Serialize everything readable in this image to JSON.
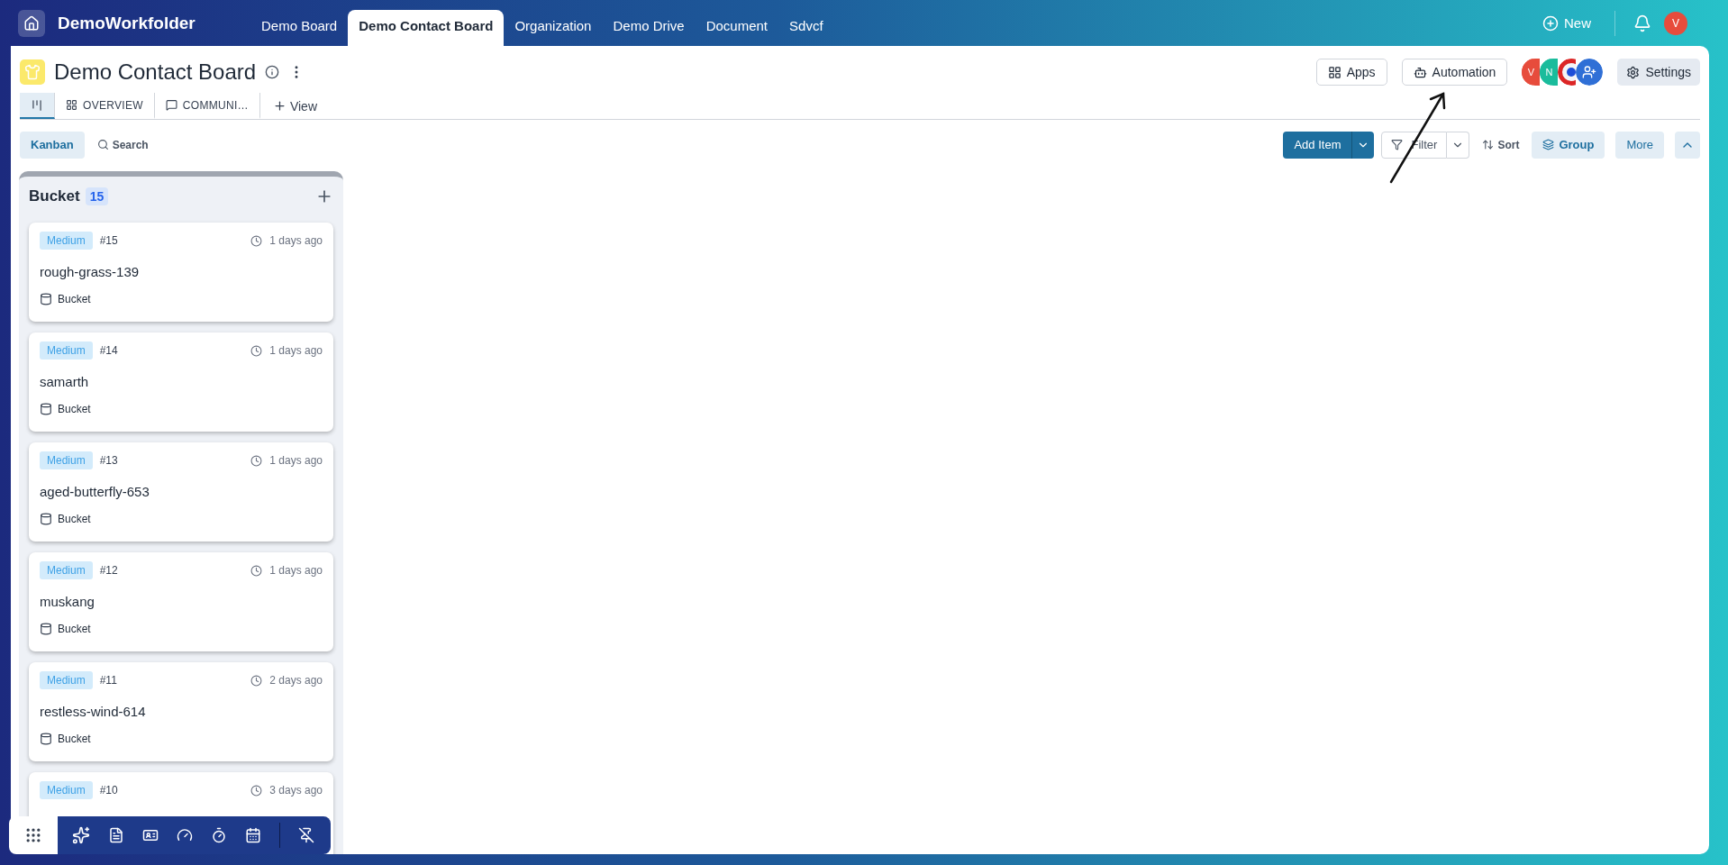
{
  "app": {
    "name": "DemoWorkfolder"
  },
  "nav_tabs": [
    {
      "label": "Demo Board",
      "selected": false
    },
    {
      "label": "Demo Contact Board",
      "selected": true
    },
    {
      "label": "Organization",
      "selected": false
    },
    {
      "label": "Demo Drive",
      "selected": false
    },
    {
      "label": "Document",
      "selected": false
    },
    {
      "label": "Sdvcf",
      "selected": false
    }
  ],
  "header_actions": {
    "new": "New",
    "user_initial": "V"
  },
  "board": {
    "title": "Demo Contact Board",
    "apps": "Apps",
    "automation": "Automation",
    "settings": "Settings",
    "members": [
      {
        "kind": "initial",
        "initial": "V",
        "color": "#e74c3c"
      },
      {
        "kind": "initial",
        "initial": "N",
        "color": "#1abc9c"
      },
      {
        "kind": "shield"
      },
      {
        "kind": "add"
      }
    ]
  },
  "view_tabs": [
    {
      "kind": "kanban",
      "selected": true
    },
    {
      "kind": "grid",
      "label": "OVERVIEW",
      "selected": false
    },
    {
      "kind": "chat",
      "label": "COMMUNI…",
      "selected": false
    }
  ],
  "add_view": "View",
  "toolbar": {
    "view_mode": "Kanban",
    "search": "Search",
    "add_item": "Add Item",
    "filter": "Filter",
    "sort": "Sort",
    "group": "Group",
    "more": "More"
  },
  "columns": [
    {
      "title": "Bucket",
      "count": "15",
      "cards": [
        {
          "priority": "Medium",
          "number": "#15",
          "time": "1 days ago",
          "title": "rough-grass-139",
          "bucket": "Bucket"
        },
        {
          "priority": "Medium",
          "number": "#14",
          "time": "1 days ago",
          "title": "samarth",
          "bucket": "Bucket"
        },
        {
          "priority": "Medium",
          "number": "#13",
          "time": "1 days ago",
          "title": "aged-butterfly-653",
          "bucket": "Bucket"
        },
        {
          "priority": "Medium",
          "number": "#12",
          "time": "1 days ago",
          "title": "muskang",
          "bucket": "Bucket"
        },
        {
          "priority": "Medium",
          "number": "#11",
          "time": "2 days ago",
          "title": "restless-wind-614",
          "bucket": "Bucket"
        },
        {
          "priority": "Medium",
          "number": "#10",
          "time": "3 days ago"
        }
      ]
    }
  ]
}
